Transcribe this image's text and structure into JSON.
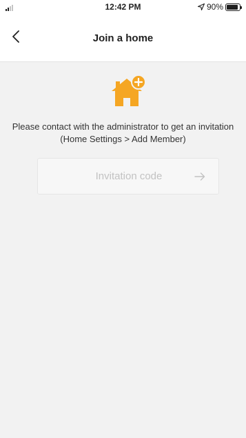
{
  "status_bar": {
    "time": "12:42 PM",
    "battery_percent": "90%",
    "battery_level": 0.9,
    "location_icon": "location-arrow-icon",
    "signal_icon": "cellular-signal-icon"
  },
  "nav": {
    "title": "Join a home",
    "back_icon": "chevron-left-icon"
  },
  "content": {
    "illustration_icon": "home-add-icon",
    "instruction": "Please contact with the administrator to get an invitation (Home Settings > Add Member)",
    "invitation_input": {
      "placeholder": "Invitation code",
      "value": ""
    },
    "submit_icon": "arrow-right-icon"
  },
  "colors": {
    "accent": "#F5A623",
    "background": "#F2F2F2",
    "placeholder": "#C2C2C2"
  }
}
